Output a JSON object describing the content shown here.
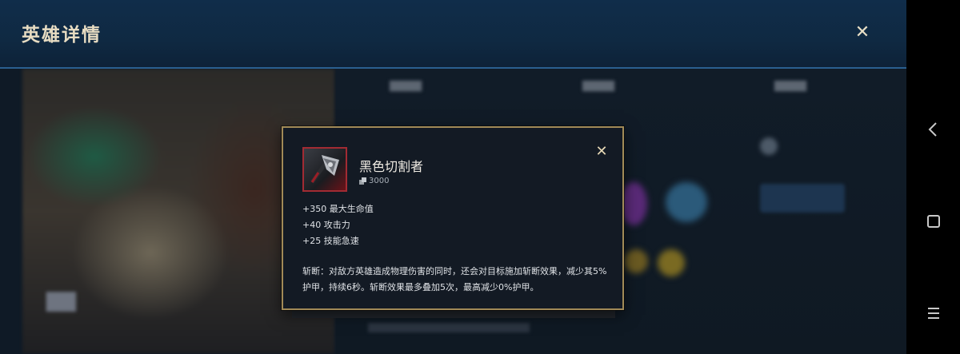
{
  "header": {
    "title": "英雄详情",
    "close_symbol": "✕"
  },
  "item": {
    "name": "黑色切割者",
    "cost": "3000",
    "stats": [
      "+350 最大生命值",
      "+40 攻击力",
      "+25 技能急速"
    ],
    "description": "斩断：对敌方英雄造成物理伤害的同时，还会对目标施加斩断效果，减少其5%护甲，持续6秒。斩断效果最多叠加5次，最高减少0%护甲。",
    "close_symbol": "✕",
    "icon": "black-cleaver-axe-icon"
  },
  "navbar": {
    "buttons": [
      "back-icon",
      "home-icon",
      "menu-icon"
    ]
  },
  "colors": {
    "header_bg": "#0f2942",
    "popup_border": "#a18a57",
    "title_text": "#e7dcc2"
  }
}
